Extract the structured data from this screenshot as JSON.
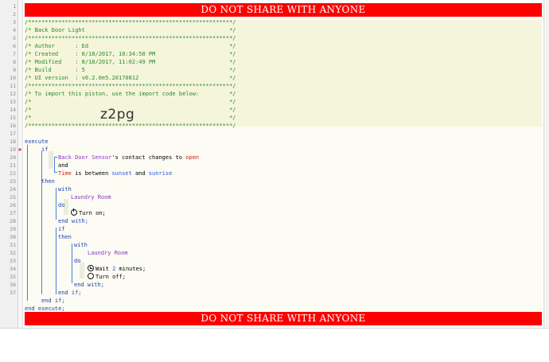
{
  "banner": {
    "top_text": "DO NOT SHARE WITH ANYONE",
    "bottom_text": "DO NOT SHARE WITH ANYONE"
  },
  "line_numbers": [
    "1",
    "2",
    "3",
    "4",
    "5",
    "6",
    "7",
    "8",
    "9",
    "10",
    "11",
    "12",
    "13",
    "14",
    "15",
    "16",
    "17",
    "18",
    "19",
    "20",
    "21",
    "22",
    "23",
    "24",
    "25",
    "26",
    "27",
    "28",
    "29",
    "30",
    "31",
    "32",
    "33",
    "34",
    "35",
    "36",
    "37"
  ],
  "error_marker": "✱",
  "watermark": "z2pg",
  "header": {
    "l1": "/*************************************************************/",
    "l2": "/* Back Door Light                                           */",
    "l3": "/*************************************************************/",
    "l4": "/* Author      : Ed                                          */",
    "l5": "/* Created     : 8/18/2017, 10:34:58 PM                      */",
    "l6": "/* Modified    : 8/18/2017, 11:02:49 PM                      */",
    "l7": "/* Build       : 5                                           */",
    "l8": "/* UI version  : v0.2.0e5.20170812                           */",
    "l9": "/*************************************************************/",
    "l10": "/* To import this piston, use the import code below:         */",
    "l11": "/*                                                           */",
    "l12": "/*                                                           */",
    "l13": "/*                                                           */",
    "l14": "/*************************************************************/"
  },
  "code": {
    "execute": "execute",
    "if1": "if",
    "c1_device": "Back Door Sensor",
    "c1_mid": "'s contact changes to ",
    "c1_value": "open",
    "and": "and",
    "c2_var": "Time",
    "c2_mid": " is between ",
    "c2_v1": "sunset",
    "c2_and": " and ",
    "c2_v2": "sunrise",
    "then1": "then",
    "with1": "with",
    "dev1": "Laundry Room",
    "do1": "do",
    "turn_on": "Turn on;",
    "end_with1": "end with;",
    "if2": "if",
    "then2": "then",
    "with2": "with",
    "dev2": "Laundry Room",
    "do2": "do",
    "wait_pre": "Wait ",
    "wait_num": "2",
    "wait_post": " minutes;",
    "turn_off": "Turn off;",
    "end_with2": "end with;",
    "end_if2": "end if;",
    "end_if1": "end if;",
    "end_execute": "end execute;"
  }
}
